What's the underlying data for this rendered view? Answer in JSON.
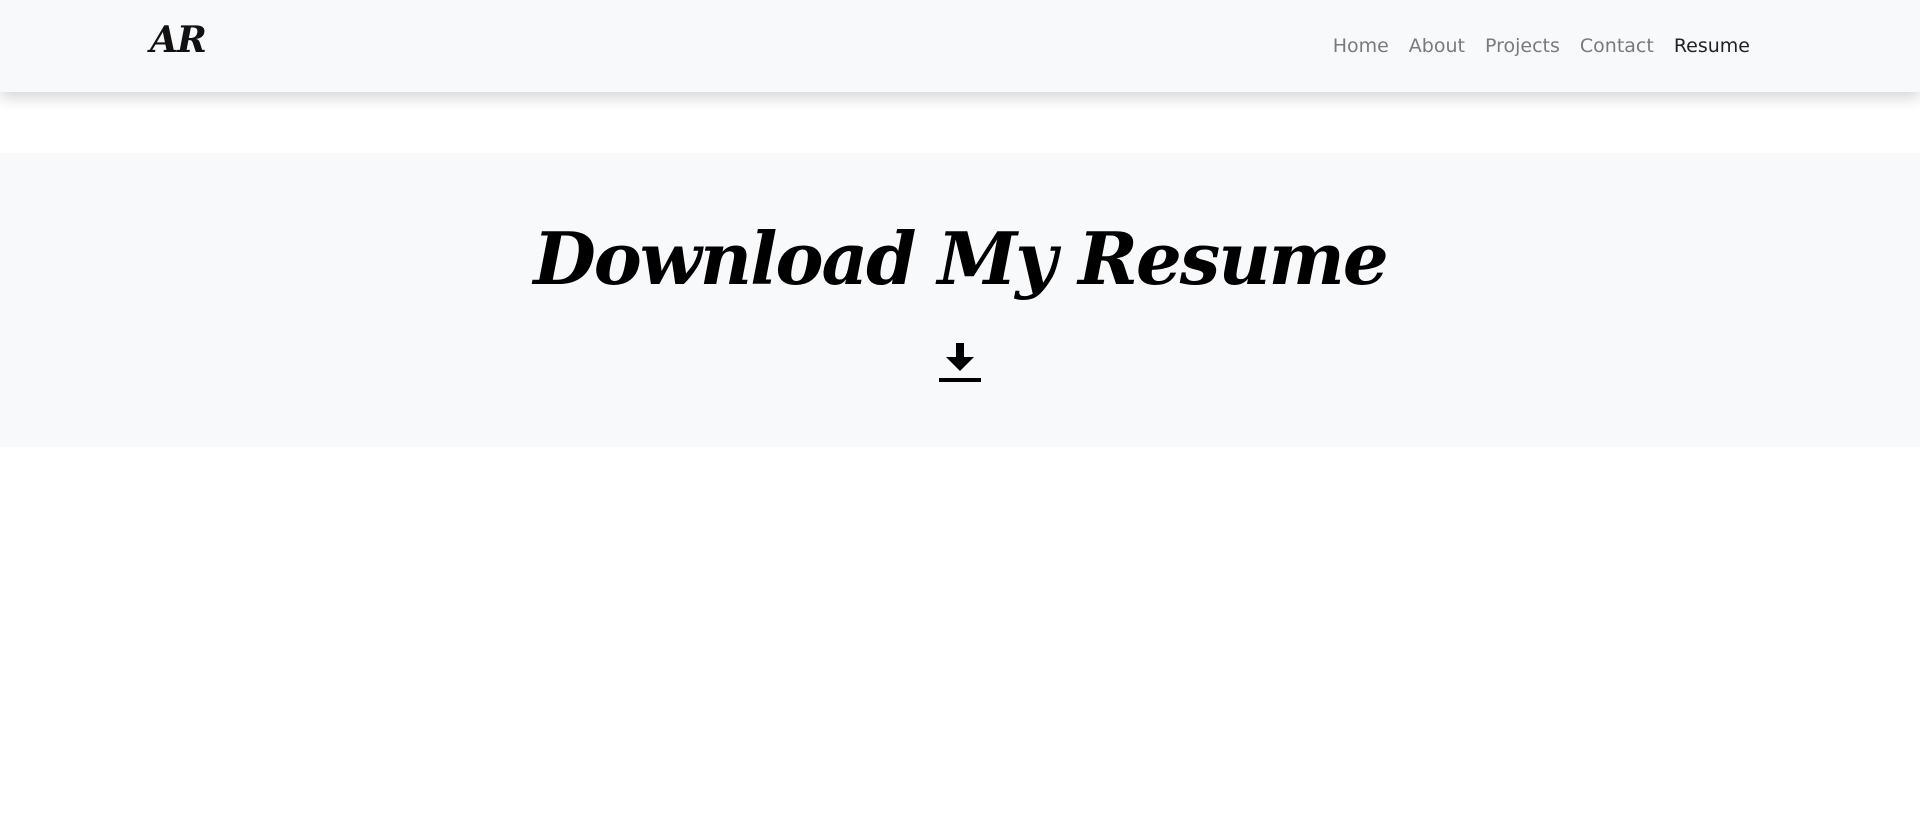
{
  "navbar": {
    "brand": "AR",
    "links": [
      {
        "label": "Home"
      },
      {
        "label": "About"
      },
      {
        "label": "Projects"
      },
      {
        "label": "Contact"
      },
      {
        "label": "Resume"
      }
    ],
    "active_link": "Resume"
  },
  "hero": {
    "title": "Download My Resume",
    "download_icon": "download-icon"
  },
  "colors": {
    "navbar_background": "#f8f9fa",
    "hero_background": "#f8f9fa",
    "page_background": "#ffffff",
    "nav_link": "#7a7a7a",
    "nav_link_active": "#222222",
    "title": "#000000"
  }
}
